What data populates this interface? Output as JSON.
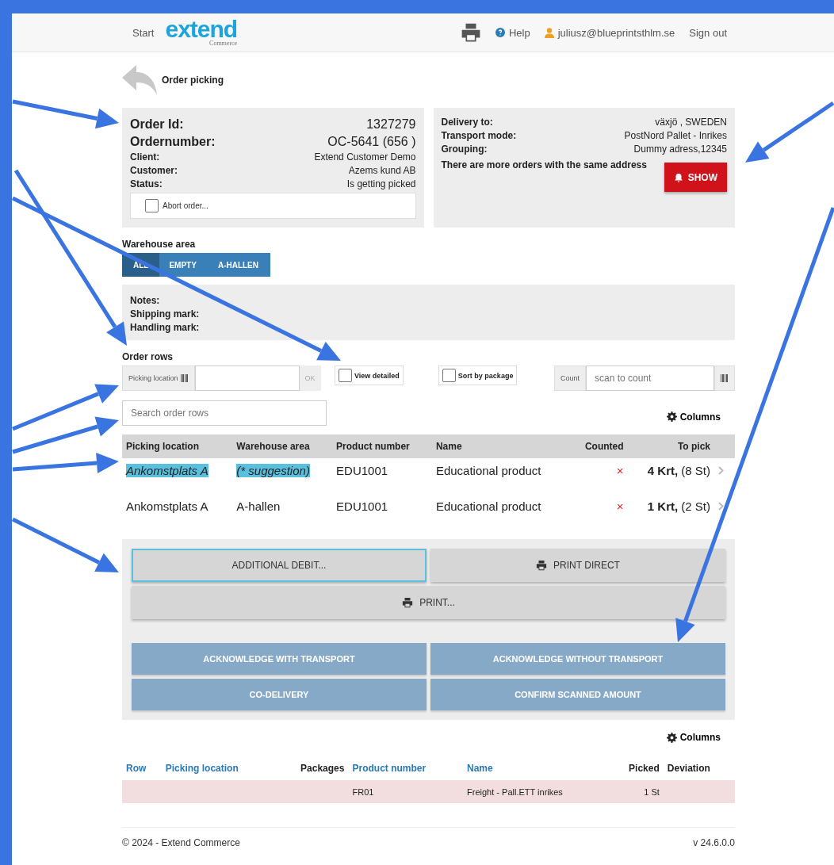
{
  "nav": {
    "start": "Start",
    "logo": "extend",
    "logo_sub": "Commerce",
    "help": "Help",
    "user": "juliusz@blueprintsthlm.se",
    "sign_out": "Sign out"
  },
  "page_title": "Order picking",
  "order": [
    {
      "label": "Order Id:",
      "value": "1327279",
      "large": true
    },
    {
      "label": "Ordernumber:",
      "value": "OC-5641 (656 )",
      "large": true
    },
    {
      "label": "Client:",
      "value": "Extend Customer Demo",
      "large": false
    },
    {
      "label": "Customer:",
      "value": "Azems kund AB",
      "large": false
    },
    {
      "label": "Status:",
      "value": "Is getting picked",
      "large": false
    }
  ],
  "abort": {
    "label": "Abort order...",
    "checked": false
  },
  "delivery": [
    {
      "label": "Delivery to:",
      "value": "växjö , SWEDEN"
    },
    {
      "label": "Transport mode:",
      "value": "PostNord Pallet - Inrikes"
    },
    {
      "label": "Grouping:",
      "value": "Dummy adress,12345"
    }
  ],
  "same_address": {
    "text": "There are more orders with the same address",
    "button": "SHOW"
  },
  "warehouse_area": {
    "label": "Warehouse area",
    "tabs": [
      {
        "label": "ALL",
        "selected": true
      },
      {
        "label": "EMPTY",
        "selected": false
      },
      {
        "label": "A-HALLEN",
        "selected": false
      }
    ]
  },
  "notes": [
    "Notes:",
    "Shipping mark:",
    "Handling mark:"
  ],
  "order_rows": {
    "title": "Order rows",
    "picking_location": "Picking location",
    "ok": "OK",
    "view_detailed": {
      "label": "View detailed",
      "checked": false
    },
    "sort_by_package": {
      "label": "Sort by package",
      "checked": false
    },
    "count": {
      "label": "Count",
      "placeholder": "scan to count"
    },
    "search": {
      "placeholder": "Search order rows"
    },
    "columns_button": "Columns",
    "columns": [
      "Picking location",
      "Warehouse area",
      "Product number",
      "Name",
      "Counted",
      "To pick"
    ],
    "rows": [
      {
        "location": "Ankomstplats A",
        "area": "(* suggestion)",
        "product": "EDU1001",
        "name": "Educational product",
        "counted": false,
        "counted_mark": "×",
        "qty": "4 Krt,",
        "units": "(8 St)",
        "suggested": true
      },
      {
        "location": "Ankomstplats A",
        "area": "A-hallen",
        "product": "EDU1001",
        "name": "Educational product",
        "counted": false,
        "counted_mark": "×",
        "qty": "1 Krt,",
        "units": "(2 St)",
        "suggested": false
      }
    ]
  },
  "actions": [
    {
      "label": "ADDITIONAL DEBIT...",
      "kind": "plain",
      "focused": true,
      "disabled": false
    },
    {
      "label": "PRINT DIRECT",
      "kind": "print",
      "focused": false,
      "disabled": false
    },
    {
      "label": "PRINT...",
      "kind": "wideprint",
      "focused": false,
      "disabled": false
    }
  ],
  "confirm_actions": [
    {
      "label": "ACKNOWLEDGE WITH TRANSPORT",
      "disabled": true
    },
    {
      "label": "ACKNOWLEDGE WITHOUT TRANSPORT",
      "disabled": true
    },
    {
      "label": "CO-DELIVERY",
      "disabled": true
    },
    {
      "label": "CONFIRM SCANNED AMOUNT",
      "disabled": true
    }
  ],
  "picked": {
    "columns_button": "Columns",
    "columns": [
      {
        "label": "Row",
        "sortable": true
      },
      {
        "label": "Picking location",
        "sortable": true
      },
      {
        "label": "Packages",
        "sortable": false
      },
      {
        "label": "Product number",
        "sortable": true
      },
      {
        "label": "Name",
        "sortable": true
      },
      {
        "label": "Picked",
        "sortable": false
      },
      {
        "label": "Deviation",
        "sortable": false
      }
    ],
    "rows": [
      {
        "cells": [
          "",
          "",
          "",
          "FR01",
          "Freight - Pall.ETT inrikes",
          "1 St",
          ""
        ]
      }
    ]
  },
  "footer": {
    "copyright": "© 2024 - Extend Commerce",
    "version": "v 24.6.0.0"
  }
}
